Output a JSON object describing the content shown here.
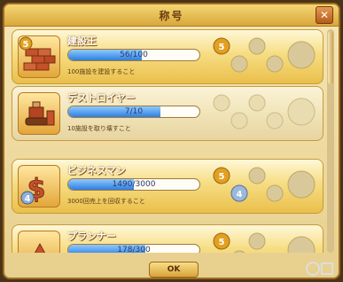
{
  "title": "称号",
  "buttons": {
    "close": "✕",
    "ok": "OK"
  },
  "titles": [
    {
      "name": "建設王",
      "progress": "56/100",
      "progress_fraction": 0.56,
      "description": "100施設を建設すること",
      "icon": "bricks-icon",
      "level_badge": "5",
      "medal_label": "5",
      "medals_earned": 1,
      "active": true
    },
    {
      "name": "デストロイヤー",
      "progress": "7/10",
      "progress_fraction": 0.7,
      "description": "10施設を取り壊すこと",
      "icon": "bulldozer-icon",
      "level_badge": "",
      "medal_label": "",
      "medals_earned": 0,
      "active": false
    },
    {
      "name": "ビジネスマン",
      "progress": "1490/3000",
      "progress_fraction": 0.497,
      "description": "3000回売上を回収すること",
      "icon": "dollar-icon",
      "level_badge": "4",
      "medal_label": "5",
      "medal_label_2": "4",
      "medals_earned": 2,
      "active": true
    },
    {
      "name": "プランナー",
      "progress": "178/300",
      "progress_fraction": 0.59,
      "description": "",
      "icon": "planner-icon",
      "level_badge": "",
      "medal_label": "5",
      "medals_earned": 1,
      "active": true
    }
  ],
  "colors": {
    "card_active": "#f1cf5e",
    "card_inactive": "#efe2b5",
    "bar_fill": "#2e7fe0",
    "medal_gold": "#e2a020",
    "medal_empty": "#d9c99a"
  }
}
